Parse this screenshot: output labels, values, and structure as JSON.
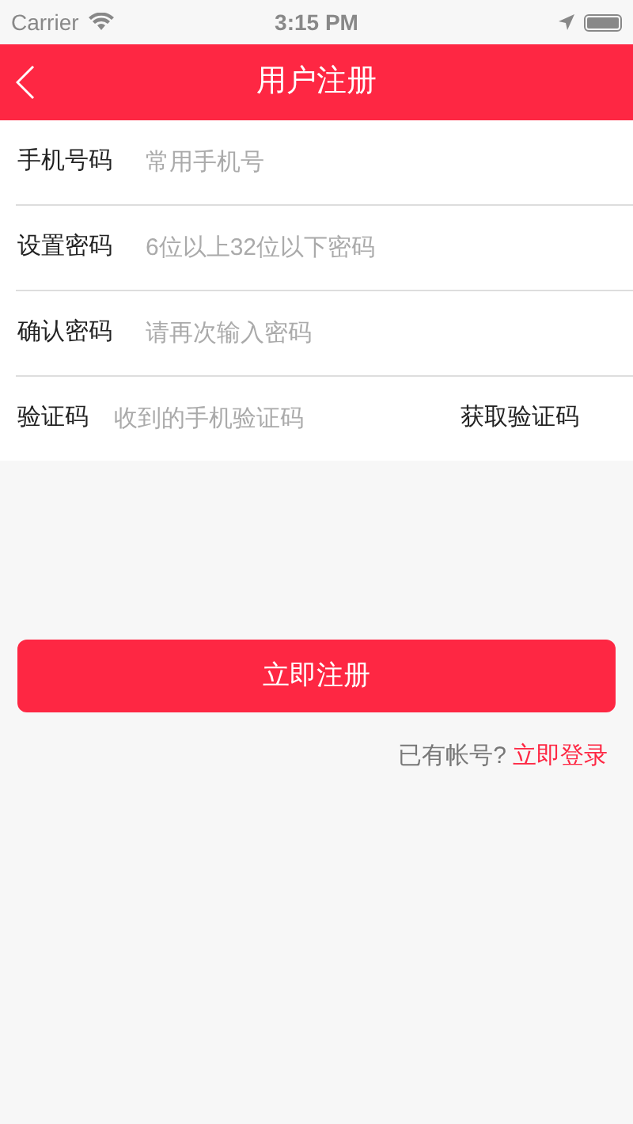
{
  "status_bar": {
    "carrier": "Carrier",
    "time": "3:15 PM"
  },
  "header": {
    "title": "用户注册"
  },
  "fields": [
    {
      "label": "手机号码",
      "placeholder": "常用手机号"
    },
    {
      "label": "设置密码",
      "placeholder": "6位以上32位以下密码"
    },
    {
      "label": "确认密码",
      "placeholder": "请再次输入密码"
    },
    {
      "label": "验证码",
      "placeholder": "收到的手机验证码",
      "action": "获取验证码"
    }
  ],
  "submit_button": "立即注册",
  "login_prompt": {
    "text": "已有帐号?",
    "link": "立即登录"
  }
}
